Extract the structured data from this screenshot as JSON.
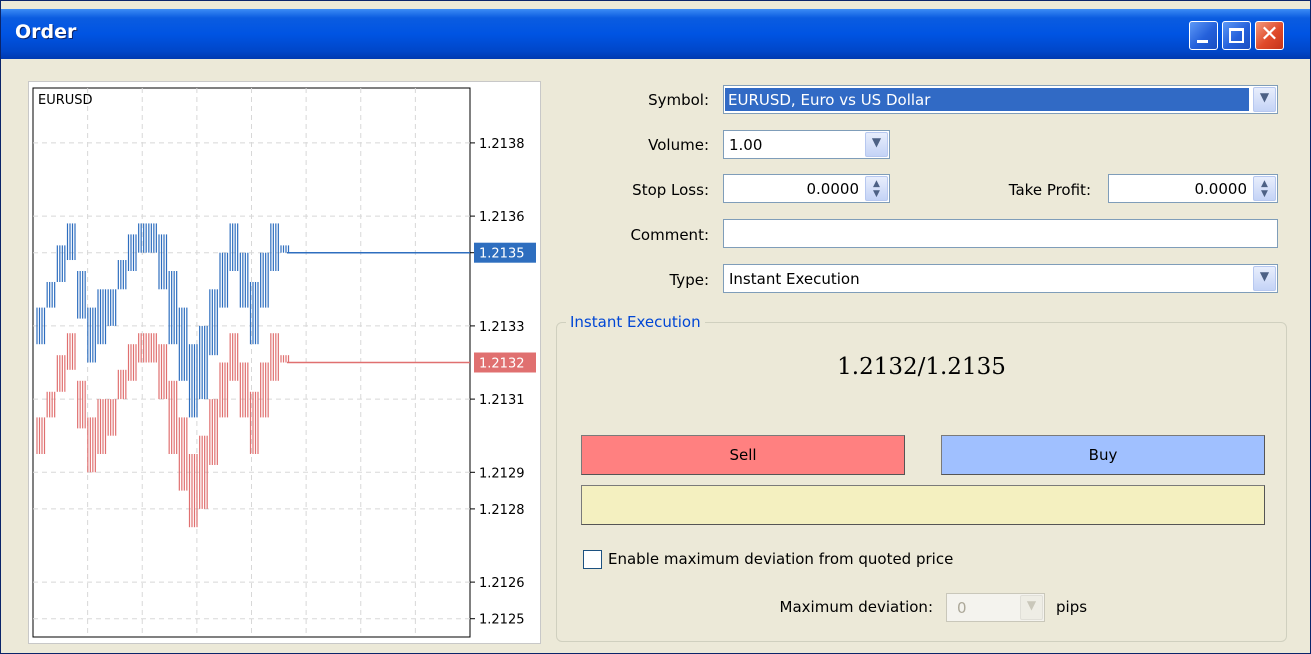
{
  "window": {
    "title": "Order"
  },
  "titlebar_buttons": {
    "minimize": "minimize-icon",
    "maximize": "maximize-icon",
    "close": "close-icon"
  },
  "chart_data": {
    "type": "bar",
    "title": "EURUSD",
    "ylim": [
      1.21245,
      1.21395
    ],
    "y_ticks": [
      "1.2138",
      "1.2136",
      "1.2135",
      "1.2133",
      "1.2131",
      "1.2129",
      "1.2128",
      "1.2126",
      "1.2125"
    ],
    "grid": true,
    "ask_line": {
      "value": 1.2135,
      "label": "1.2135",
      "color": "#2E6EBF"
    },
    "bid_line": {
      "value": 1.2132,
      "label": "1.2132",
      "color": "#E07070"
    },
    "series": [
      {
        "name": "",
        "color": "#2E6EBF",
        "values": [
          [
            1.21325,
            1.21335
          ],
          [
            1.21335,
            1.21342
          ],
          [
            1.21342,
            1.21352
          ],
          [
            1.21348,
            1.21358
          ],
          [
            1.21332,
            1.21345
          ],
          [
            1.2132,
            1.21335
          ],
          [
            1.21325,
            1.2134
          ],
          [
            1.2133,
            1.2134
          ],
          [
            1.2134,
            1.21348
          ],
          [
            1.21345,
            1.21355
          ],
          [
            1.2135,
            1.21358
          ],
          [
            1.2135,
            1.21358
          ],
          [
            1.2134,
            1.21355
          ],
          [
            1.21325,
            1.21345
          ],
          [
            1.21315,
            1.21335
          ],
          [
            1.21305,
            1.21325
          ],
          [
            1.2131,
            1.2133
          ],
          [
            1.21322,
            1.2134
          ],
          [
            1.21335,
            1.2135
          ],
          [
            1.21345,
            1.21358
          ],
          [
            1.21335,
            1.2135
          ],
          [
            1.21325,
            1.21342
          ],
          [
            1.21335,
            1.2135
          ],
          [
            1.21345,
            1.21358
          ],
          [
            1.2135,
            1.21352
          ]
        ]
      },
      {
        "name": "",
        "color": "#E07070",
        "values": [
          [
            1.21295,
            1.21305
          ],
          [
            1.21305,
            1.21312
          ],
          [
            1.21312,
            1.21322
          ],
          [
            1.21318,
            1.21328
          ],
          [
            1.21302,
            1.21315
          ],
          [
            1.2129,
            1.21305
          ],
          [
            1.21295,
            1.2131
          ],
          [
            1.213,
            1.2131
          ],
          [
            1.2131,
            1.21318
          ],
          [
            1.21315,
            1.21325
          ],
          [
            1.2132,
            1.21328
          ],
          [
            1.2132,
            1.21328
          ],
          [
            1.2131,
            1.21325
          ],
          [
            1.21295,
            1.21315
          ],
          [
            1.21285,
            1.21305
          ],
          [
            1.21275,
            1.21295
          ],
          [
            1.2128,
            1.213
          ],
          [
            1.21292,
            1.2131
          ],
          [
            1.21305,
            1.2132
          ],
          [
            1.21315,
            1.21328
          ],
          [
            1.21305,
            1.2132
          ],
          [
            1.21295,
            1.21312
          ],
          [
            1.21305,
            1.2132
          ],
          [
            1.21315,
            1.21328
          ],
          [
            1.2132,
            1.21322
          ]
        ]
      }
    ]
  },
  "form": {
    "symbol_label": "Symbol:",
    "symbol_value": "EURUSD, Euro vs US Dollar",
    "volume_label": "Volume:",
    "volume_value": "1.00",
    "stop_loss_label": "Stop Loss:",
    "stop_loss_value": "0.0000",
    "take_profit_label": "Take Profit:",
    "take_profit_value": "0.0000",
    "comment_label": "Comment:",
    "comment_value": "",
    "type_label": "Type:",
    "type_value": "Instant Execution"
  },
  "execution": {
    "group_title": "Instant Execution",
    "price": "1.2132/1.2135",
    "sell_label": "Sell",
    "buy_label": "Buy",
    "enable_deviation_label": "Enable maximum deviation from quoted price",
    "enable_deviation_checked": false,
    "max_deviation_label": "Maximum deviation:",
    "max_deviation_value": "0",
    "pips_label": "pips"
  }
}
